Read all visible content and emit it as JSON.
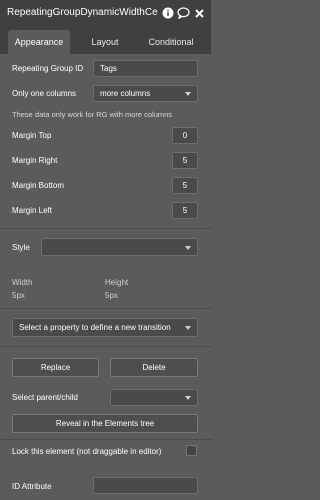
{
  "header": {
    "title": "RepeatingGroupDynamicWidthCe",
    "icons": [
      "info-icon",
      "comment-icon",
      "close-icon"
    ]
  },
  "tabs": [
    "Appearance",
    "Layout",
    "Conditional"
  ],
  "fields": {
    "repeating_group_id_label": "Repeating Group ID",
    "repeating_group_id_value": "Tags",
    "only_one_columns_label": "Only one columns",
    "only_one_columns_value": "more columns",
    "rg_note": "These data only work for RG with more columns",
    "margin_top_label": "Margin Top",
    "margin_top_value": "0",
    "margin_right_label": "Margin Right",
    "margin_right_value": "5",
    "margin_bottom_label": "Margin Bottom",
    "margin_bottom_value": "5",
    "margin_left_label": "Margin Left",
    "margin_left_value": "5",
    "style_label": "Style",
    "width_label": "Width",
    "width_value": "5px",
    "height_label": "Height",
    "height_value": "5px",
    "transition_placeholder": "Select a property to define a new transition",
    "select_parent_label": "Select parent/child",
    "lock_label": "Lock this element (not draggable in editor)",
    "id_attribute_label": "ID Attribute"
  },
  "buttons": {
    "replace": "Replace",
    "delete": "Delete",
    "reveal": "Reveal in the Elements tree"
  },
  "colors": {
    "panel_bg": "#5b5b5b",
    "header_bg": "#404040",
    "field_bg": "#4a4a4a",
    "text": "#ffffff"
  }
}
